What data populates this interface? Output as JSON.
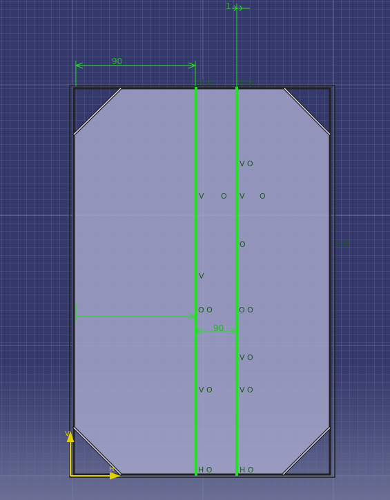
{
  "dimensions": {
    "top_width": "90",
    "bottom_width": "90",
    "offset": "1"
  },
  "constraints": {
    "h_top_left": "H O",
    "h_top_right": "H O",
    "v_right_1": "V O",
    "v_left_mid": "V",
    "o_mid_1": "O",
    "v_right_mid": "V",
    "o_right_mid": "O",
    "o_center": "O",
    "v_outer_right": "V O",
    "v_left_low": "V",
    "oo_left": "O O",
    "oo_right": "O O",
    "v_right_low1": "V O",
    "v_left_low2": "V O",
    "v_right_low2": "V O",
    "h_bottom_left": "H O",
    "h_bottom_right": "H O"
  },
  "axis": {
    "v_label": "V",
    "h_label": "H"
  },
  "colors": {
    "background": "#35386a",
    "plate": "#a3a5c9",
    "highlight": "#22e022",
    "outline": "#1a1a1a"
  }
}
